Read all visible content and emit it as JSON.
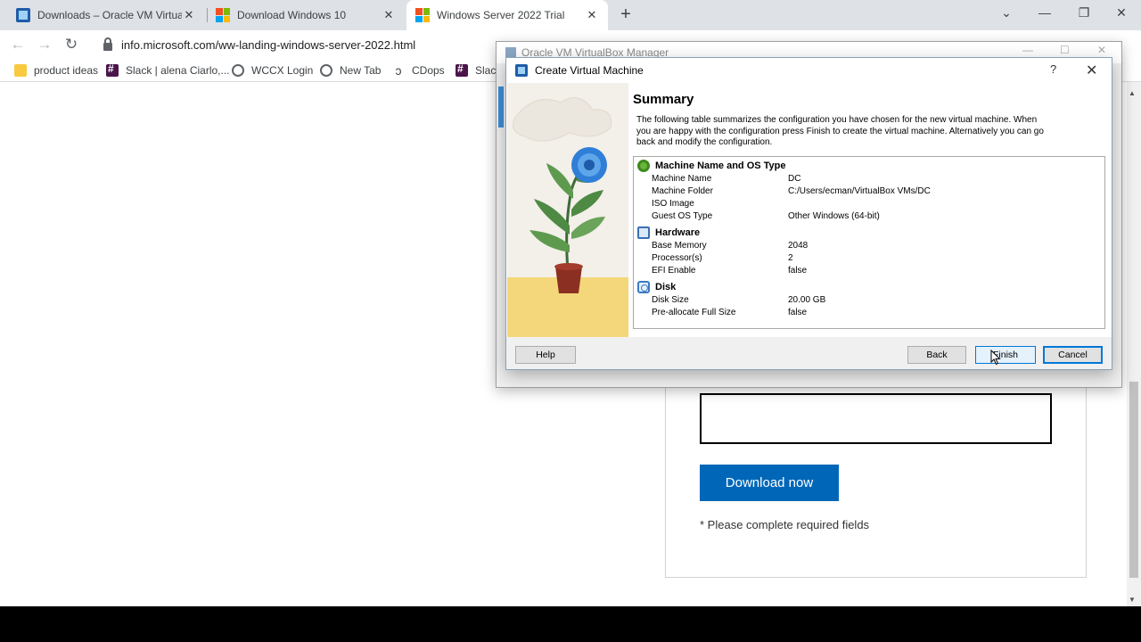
{
  "browser": {
    "tabs": [
      {
        "title": "Downloads – Oracle VM VirtualBox",
        "icon": "virtualbox-favicon",
        "active": false
      },
      {
        "title": "Download Windows 10",
        "icon": "microsoft-favicon",
        "active": false
      },
      {
        "title": "Windows Server 2022 Trial",
        "icon": "microsoft-favicon",
        "active": true
      }
    ],
    "url": "info.microsoft.com/ww-landing-windows-server-2022.html",
    "bookmarks": [
      {
        "label": "product ideas",
        "icon": "folder-icon"
      },
      {
        "label": "Slack | alena Ciarlo,...",
        "icon": "slack-icon"
      },
      {
        "label": "WCCX Login",
        "icon": "globe-icon"
      },
      {
        "label": "New Tab",
        "icon": "globe-icon"
      },
      {
        "label": "CDops",
        "icon": "cdops-icon"
      },
      {
        "label": "Slack",
        "icon": "slack-icon"
      }
    ]
  },
  "page": {
    "download_button": "Download now",
    "required_note": "* Please complete required fields"
  },
  "vbox_manager": {
    "title": "Oracle VM VirtualBox Manager"
  },
  "dialog": {
    "title": "Create Virtual Machine",
    "help_glyph": "?",
    "heading": "Summary",
    "description": "The following table summarizes the configuration you have chosen for the new virtual machine. When you are happy with the configuration press Finish to create the virtual machine. Alternatively you can go back and modify the configuration.",
    "sections": [
      {
        "title": "Machine Name and OS Type",
        "icon": "gear-icon",
        "rows": [
          {
            "key": "Machine Name",
            "value": "DC"
          },
          {
            "key": "Machine Folder",
            "value": "C:/Users/ecman/VirtualBox VMs/DC"
          },
          {
            "key": "ISO Image",
            "value": ""
          },
          {
            "key": "Guest OS Type",
            "value": "Other Windows (64-bit)"
          }
        ]
      },
      {
        "title": "Hardware",
        "icon": "chip-icon",
        "rows": [
          {
            "key": "Base Memory",
            "value": "2048"
          },
          {
            "key": "Processor(s)",
            "value": "2"
          },
          {
            "key": "EFI Enable",
            "value": "false"
          }
        ]
      },
      {
        "title": "Disk",
        "icon": "disk-icon",
        "rows": [
          {
            "key": "Disk Size",
            "value": "20.00 GB"
          },
          {
            "key": "Pre-allocate Full Size",
            "value": "false"
          }
        ]
      }
    ],
    "buttons": {
      "help": "Help",
      "back": "Back",
      "finish": "Finish",
      "cancel": "Cancel"
    }
  },
  "colors": {
    "accent": "#0067b8",
    "focus": "#0078d7",
    "art_yellow": "#f4d77a",
    "flower_blue": "#2f7fd8"
  }
}
